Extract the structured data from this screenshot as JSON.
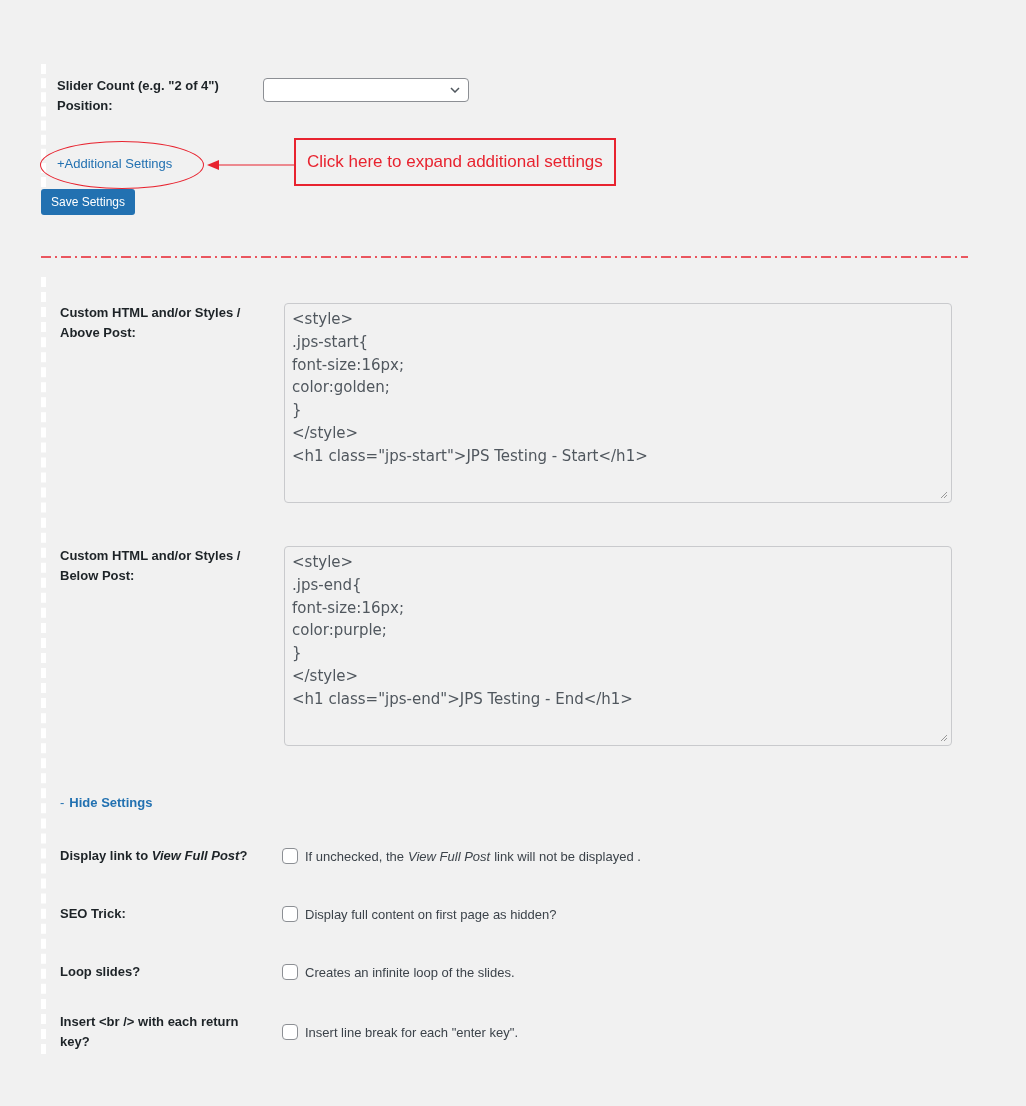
{
  "slider_count": {
    "label": "Slider Count (e.g. \"2 of 4\") Position:"
  },
  "additional_settings_link": "+Additional Settings",
  "annotation": {
    "text": "Click here to expand additional settings"
  },
  "save_button": "Save Settings",
  "custom_fields": [
    {
      "label": "Custom HTML and/or Styles / Above Post:",
      "lines": [
        "<style>",
        ".jps-start{",
        "font-size:16px;",
        "color:golden;",
        "}",
        "</style>",
        "<h1 class=\"jps-start\">JPS Testing - Start</h1>"
      ]
    },
    {
      "label": "Custom HTML and/or Styles / Below Post:",
      "lines": [
        "<style>",
        ".jps-end{",
        "font-size:16px;",
        "color:purple;",
        "}",
        "</style>",
        "<h1 class=\"jps-end\">JPS Testing - End</h1>"
      ]
    }
  ],
  "hide_settings": {
    "dash": "-",
    "link": "Hide Settings"
  },
  "options": [
    {
      "label": "Display link to *View Full Post*?",
      "description": [
        {
          "text": "If unchecked, the",
          "italic": false
        },
        {
          "text": "View Full Post",
          "italic": true
        },
        {
          "text": "link will not be displayed .",
          "italic": false
        }
      ],
      "checked": false
    },
    {
      "label": "SEO Trick:",
      "description": [
        {
          "text": "Display full content on first page as hidden?",
          "italic": false
        }
      ],
      "checked": false
    },
    {
      "label": "Loop slides?",
      "description": [
        {
          "text": "Creates an infinite loop of the slides.",
          "italic": false
        }
      ],
      "checked": false
    },
    {
      "label": "Insert <br /> with each return key?",
      "description": [
        {
          "text": "Insert line break for each \"enter key\".",
          "italic": false
        }
      ],
      "checked": false
    }
  ]
}
